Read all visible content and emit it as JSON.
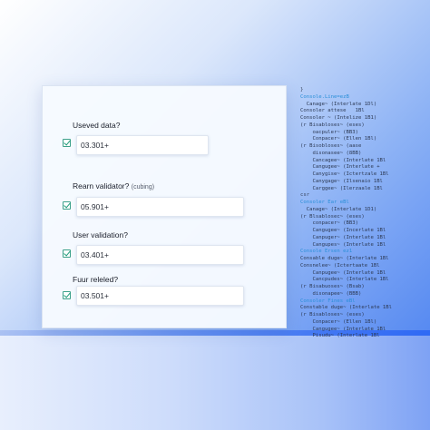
{
  "form": {
    "rows": [
      {
        "label": "Useved data?",
        "sublabel": "",
        "value": "03.301+",
        "checked": true
      },
      {
        "label": "Rearn validator?",
        "sublabel": "(cubing)",
        "value": "05.901+",
        "checked": true
      },
      {
        "label": "User validation?",
        "sublabel": "",
        "value": "03.401+",
        "checked": true
      },
      {
        "label": "Fuur releled?",
        "sublabel": "",
        "value": "03.501+",
        "checked": true
      }
    ]
  },
  "code": {
    "lines": [
      {
        "text": "}",
        "color": "#3a4660"
      },
      {
        "text": "Console.Line=ezB",
        "color": "#2b8fd8"
      },
      {
        "text": "  Canage~ (Interlate 1Dl)",
        "color": "#2d3a55"
      },
      {
        "text": "Consoler attese   1Bl",
        "color": "#2d3a55"
      },
      {
        "text": "Consoler ~ (Intelize 1B1)",
        "color": "#2d3a55"
      },
      {
        "text": "(r Bisabloses~ (eses)",
        "color": "#2d3a55"
      },
      {
        "text": "    oacpuler~ (BB3)",
        "color": "#2d3a55"
      },
      {
        "text": "    Conpacer~ (Ellen 1Bl)",
        "color": "#2d3a55"
      },
      {
        "text": "(r Bisobloses~ (aase",
        "color": "#2d3a55"
      },
      {
        "text": "    disonasee~ (8BB)",
        "color": "#2d3a55"
      },
      {
        "text": "    Cancagee~ (Interlate 1Bl",
        "color": "#2d3a55"
      },
      {
        "text": "    Cangugee~ (Interlate +",
        "color": "#2d3a55"
      },
      {
        "text": "    Canygise~ (Ictertzale 1Bl",
        "color": "#2d3a55"
      },
      {
        "text": "    Canygage~ (Ilsenaio 1Bl",
        "color": "#2d3a55"
      },
      {
        "text": "    Carggee~ (Ilerzaale 1Bl",
        "color": "#2d3a55"
      },
      {
        "text": "csr",
        "color": "#3a4660"
      },
      {
        "text": "Consoler Ear eBl",
        "color": "#2b8fd8"
      },
      {
        "text": "  Canage~ (Interlate 1D1)",
        "color": "#2d3a55"
      },
      {
        "text": "(r Blsablosec~ (eses)",
        "color": "#2d3a55"
      },
      {
        "text": "    conpacer~ (BB3)",
        "color": "#2d3a55"
      },
      {
        "text": "    Cangugee~ (Incerlate 1Bl",
        "color": "#2d3a55"
      },
      {
        "text": "    Canpuger~ (Interlate 1Bl",
        "color": "#2d3a55"
      },
      {
        "text": "    Cangupes~ (Interlate 1Bl",
        "color": "#2d3a55"
      },
      {
        "text": "Console Ersen ez1",
        "color": "#2b8fd8"
      },
      {
        "text": "Consable duge~ (Interlate 1Bl",
        "color": "#2d3a55"
      },
      {
        "text": "Consnelee~ (Ictertaate 1Bl",
        "color": "#2d3a55"
      },
      {
        "text": "    Canpugee~ (Interlate 1Bl",
        "color": "#2d3a55"
      },
      {
        "text": "    Cancpudes~ (Interlate 1Bl",
        "color": "#2d3a55"
      },
      {
        "text": "(r Bisabuoses~ (Bsab)",
        "color": "#2d3a55"
      },
      {
        "text": "    disonapee~ (BBB)",
        "color": "#2d3a55"
      },
      {
        "text": "Consoler Fines eBl",
        "color": "#2b8fd8"
      },
      {
        "text": "Constable duge~ (Interlate 1Bl",
        "color": "#2d3a55"
      },
      {
        "text": "(r Bisabloses~ (eses)",
        "color": "#2d3a55"
      },
      {
        "text": "    Conpacer~ (Ellen 1Bl)",
        "color": "#2d3a55"
      },
      {
        "text": "    Cangugee~ (Interlate 1Bl",
        "color": "#2d3a55"
      },
      {
        "text": "    Pisudu~ (Interlate 1Bl",
        "color": "#2d3a55"
      }
    ]
  }
}
